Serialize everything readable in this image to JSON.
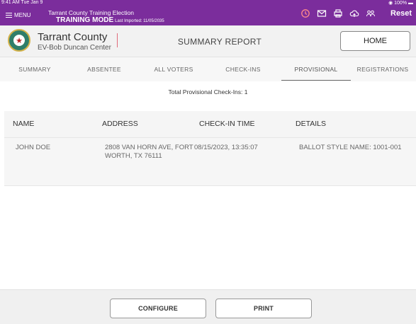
{
  "status_bar": {
    "time": "9:41 AM  Tue Jan 9",
    "battery": "◉ 100% ▬"
  },
  "topbar": {
    "menu_label": "MENU",
    "election_title": "Tarrant County Training Election",
    "mode_label": "TRAINING MODE",
    "last_imported": "Last Imported: 11/05/2035",
    "icons": [
      "history-icon",
      "mail-icon",
      "printer-icon",
      "cloud-upload-icon",
      "users-icon"
    ],
    "reset_label": "Reset"
  },
  "header": {
    "county": "Tarrant County",
    "location": "EV-Bob Duncan Center",
    "title": "SUMMARY REPORT",
    "home_label": "HOME"
  },
  "tabs": [
    {
      "label": "SUMMARY",
      "active": false
    },
    {
      "label": "ABSENTEE",
      "active": false
    },
    {
      "label": "ALL VOTERS",
      "active": false
    },
    {
      "label": "CHECK-INS",
      "active": false
    },
    {
      "label": "PROVISIONAL",
      "active": true
    },
    {
      "label": "REGISTRATIONS",
      "active": false
    }
  ],
  "summary": {
    "total_text": "Total Provisional Check-Ins: 1"
  },
  "table": {
    "columns": [
      "NAME",
      "ADDRESS",
      "CHECK-IN TIME",
      "DETAILS"
    ],
    "rows": [
      {
        "name": "JOHN DOE",
        "address_line1": "2808 VAN HORN AVE, FORT",
        "address_line2": "WORTH, TX 76111",
        "checkin_time": "08/15/2023, 13:35:07",
        "details": "BALLOT STYLE NAME: 1001-001"
      }
    ]
  },
  "footer": {
    "configure_label": "CONFIGURE",
    "print_label": "PRINT"
  },
  "colors": {
    "brand": "#7b2d9c",
    "accent_divider": "#e06a7a"
  }
}
